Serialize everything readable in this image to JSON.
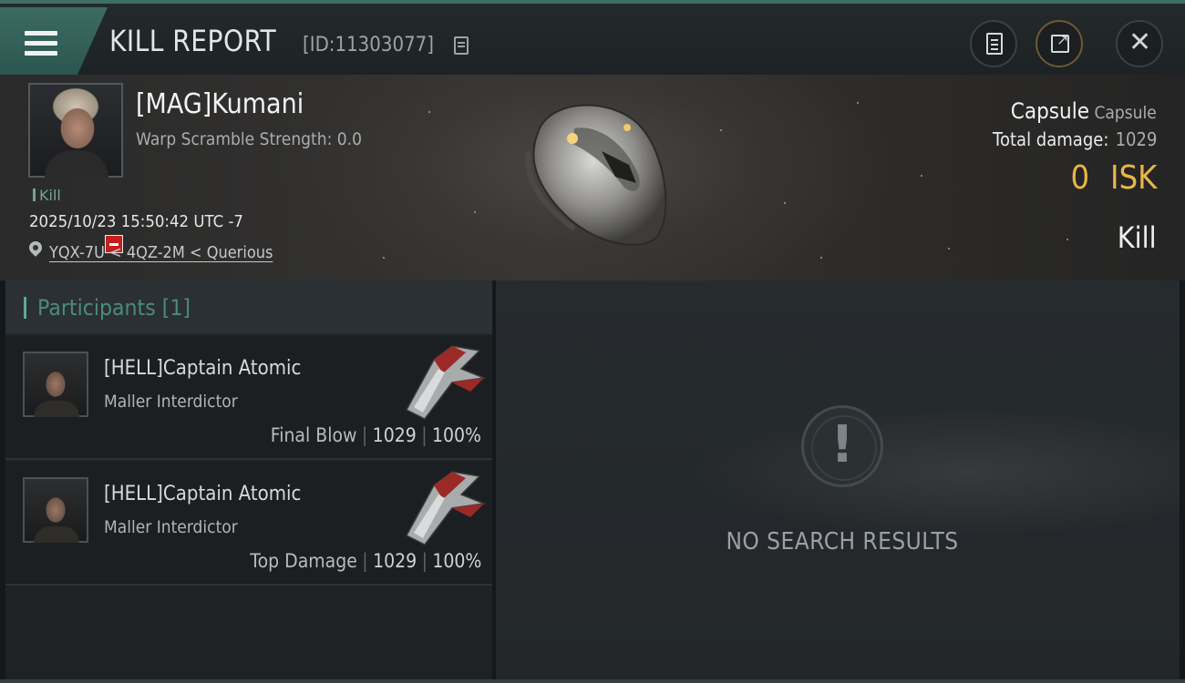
{
  "header": {
    "title": "KILL REPORT",
    "report_id": "[ID:11303077]",
    "menu_icon": "hamburger-menu-icon",
    "buttons": [
      {
        "name": "notes",
        "icon": "clipboard-icon"
      },
      {
        "name": "share",
        "icon": "external-link-icon"
      },
      {
        "name": "close",
        "icon": "close-icon",
        "glyph": "✕"
      }
    ]
  },
  "victim": {
    "name": "[MAG]Kumani",
    "warp_scramble": "Warp Scramble Strength: 0.0",
    "type_label": "Kill",
    "datetime": "2025/10/23 15:50:42 UTC -7",
    "location": "YQX-7U < 4QZ-2M < Querious",
    "ship_name": "Capsule",
    "ship_class": "Capsule",
    "total_damage_label": "Total damage:",
    "total_damage": "1029",
    "isk_value": "0 ISK",
    "result": "Kill"
  },
  "participants": {
    "header": "Participants [1]",
    "rows": [
      {
        "name": "[HELL]Captain Atomic",
        "ship": "Maller Interdictor",
        "role": "Final Blow",
        "damage": "1029",
        "percent": "100%"
      },
      {
        "name": "[HELL]Captain Atomic",
        "ship": "Maller Interdictor",
        "role": "Top Damage",
        "damage": "1029",
        "percent": "100%"
      }
    ]
  },
  "empty_state": {
    "icon": "exclamation-icon",
    "glyph": "!",
    "text": "NO SEARCH RESULTS"
  },
  "colors": {
    "accent_teal": "#3f6e66",
    "isk_gold": "#e8b64a",
    "badge_red": "#c81e1e"
  }
}
